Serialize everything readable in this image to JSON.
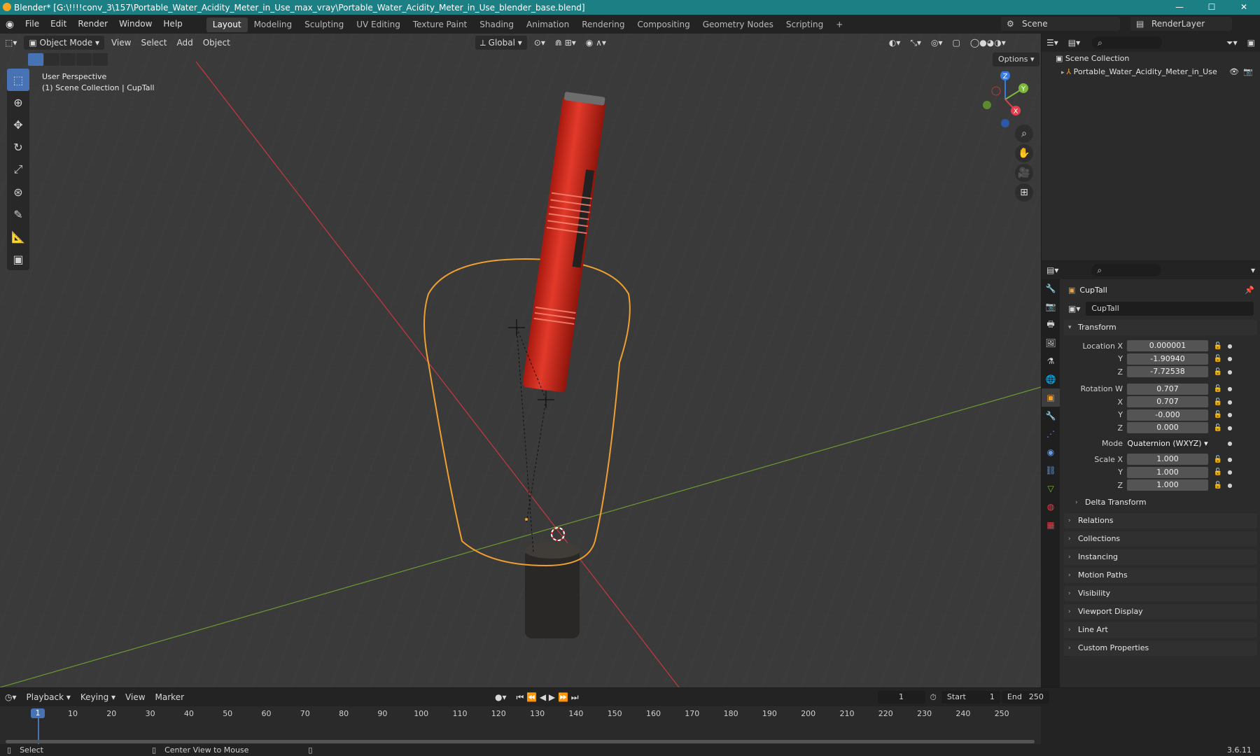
{
  "window": {
    "title": "Blender* [G:\\!!!!conv_3\\157\\Portable_Water_Acidity_Meter_in_Use_max_vray\\Portable_Water_Acidity_Meter_in_Use_blender_base.blend]",
    "minimize": "—",
    "maximize": "☐",
    "close": "✕"
  },
  "menu": {
    "items": [
      "File",
      "Edit",
      "Render",
      "Window",
      "Help"
    ],
    "workspaces": [
      "Layout",
      "Modeling",
      "Sculpting",
      "UV Editing",
      "Texture Paint",
      "Shading",
      "Animation",
      "Rendering",
      "Compositing",
      "Geometry Nodes",
      "Scripting"
    ],
    "add_workspace": "+",
    "scene": "Scene",
    "render_layer": "RenderLayer"
  },
  "viewport": {
    "mode": "Object Mode",
    "menus": [
      "View",
      "Select",
      "Add",
      "Object"
    ],
    "orientation": "Global",
    "options": "Options",
    "perspective": "User Perspective",
    "collection_info": "(1) Scene Collection | CupTall",
    "axes": {
      "x": "X",
      "y": "Y",
      "z": "Z"
    }
  },
  "outliner": {
    "scene_collection": "Scene Collection",
    "items": [
      "Portable_Water_Acidity_Meter_in_Use"
    ]
  },
  "properties": {
    "object_name": "CupTall",
    "object_field": "CupTall",
    "transform": {
      "title": "Transform",
      "location": {
        "label_x": "Location X",
        "x": "0.000001",
        "y": "-1.90940",
        "z": "-7.72538"
      },
      "rotation": {
        "label_w": "Rotation W",
        "w": "0.707",
        "x": "0.707",
        "y": "-0.000",
        "z": "0.000"
      },
      "mode_label": "Mode",
      "mode": "Quaternion (WXYZ)",
      "scale": {
        "label_x": "Scale X",
        "x": "1.000",
        "y": "1.000",
        "z": "1.000"
      },
      "axis_y": "Y",
      "axis_z": "Z",
      "axis_x": "X"
    },
    "delta": "Delta Transform",
    "panels": [
      "Relations",
      "Collections",
      "Instancing",
      "Motion Paths",
      "Visibility",
      "Viewport Display",
      "Line Art",
      "Custom Properties"
    ]
  },
  "timeline": {
    "menus": [
      "Playback",
      "Keying",
      "View",
      "Marker"
    ],
    "current_frame": "1",
    "start_label": "Start",
    "start": "1",
    "end_label": "End",
    "end": "250",
    "ticks": [
      "10",
      "20",
      "30",
      "40",
      "50",
      "60",
      "70",
      "80",
      "90",
      "100",
      "110",
      "120",
      "130",
      "140",
      "150",
      "160",
      "170",
      "180",
      "190",
      "200",
      "210",
      "220",
      "230",
      "240",
      "250"
    ]
  },
  "status": {
    "select": "Select",
    "center_view": "Center View to Mouse",
    "version": "3.6.11"
  },
  "colors": {
    "accent": "#4772b3",
    "titlebar": "#1b7f84",
    "selection_outline": "#f0a030",
    "x_axis": "#e0404e",
    "y_axis": "#7cb83a",
    "z_axis": "#3b7ae0",
    "meter_body": "#d42a1e"
  }
}
